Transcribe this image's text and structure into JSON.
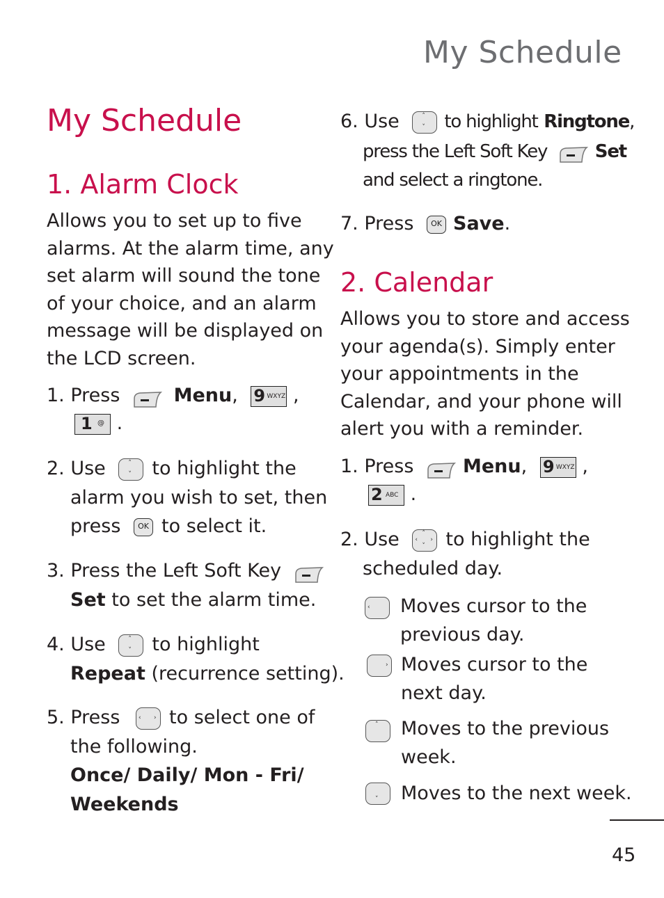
{
  "running_head": "My Schedule",
  "page_title": "My Schedule",
  "page_number": "45",
  "colors": {
    "accent": "#c8104c",
    "running_head": "#6d6e71",
    "text": "#231f20"
  },
  "alarm": {
    "heading": "1. Alarm Clock",
    "intro": [
      "Allows you to set up to five",
      "alarms. At the alarm time, any",
      "set alarm will sound the tone",
      "of your choice, and an alarm",
      "message will be displayed on",
      "the LCD screen."
    ],
    "step1": {
      "num": "1. Press",
      "menu": "Menu",
      "comma": ",",
      "key9_digit": "9",
      "key9_letters": "WXYZ",
      "key1_digit": "1",
      "period": "."
    },
    "step2": {
      "num": "2. Use",
      "t1": "to highlight the",
      "t2": "alarm you wish to set, then",
      "t3": "press",
      "t4": "to select it.",
      "ok": "OK"
    },
    "step3": {
      "num": "3. Press the Left Soft Key",
      "set": "Set",
      "t": "to set the alarm time."
    },
    "step4": {
      "num": "4. Use",
      "t1": "to highlight",
      "repeat": "Repeat",
      "t2": "(recurrence setting)."
    },
    "step5": {
      "num": "5. Press",
      "t1": "to select one of",
      "t2": "the following.",
      "opts1": "Once/ Daily/ Mon - Fri/",
      "opts2": "Weekends"
    },
    "step6": {
      "num": "6. Use",
      "t1": "to highlight",
      "ringtone": "Ringtone",
      "comma": ",",
      "t2": "press the Left Soft Key",
      "set": "Set",
      "t3": "and select a ringtone."
    },
    "step7": {
      "num": "7. Press",
      "ok": "OK",
      "save": "Save",
      "period": "."
    }
  },
  "calendar": {
    "heading": "2. Calendar",
    "intro": [
      "Allows you to store and access",
      "your agenda(s). Simply enter",
      "your appointments in the",
      "Calendar, and your phone will",
      "alert you with a reminder."
    ],
    "step1": {
      "num": "1. Press",
      "menu": "Menu",
      "comma": ",",
      "key9_digit": "9",
      "key9_letters": "WXYZ",
      "key2_digit": "2",
      "key2_letters": "ABC",
      "period": "."
    },
    "step2": {
      "num": "2. Use",
      "t1": "to highlight the",
      "t2": "scheduled day."
    },
    "nav_legend": [
      {
        "icon": "nav-left-icon",
        "line1": "Moves cursor to the",
        "line2": "previous day."
      },
      {
        "icon": "nav-right-icon",
        "line1": "Moves cursor to the",
        "line2": "next day."
      },
      {
        "icon": "nav-up-icon",
        "line1": "Moves to the previous",
        "line2": "week."
      },
      {
        "icon": "nav-down-icon",
        "line1": "Moves to the next week.",
        "line2": ""
      }
    ]
  }
}
